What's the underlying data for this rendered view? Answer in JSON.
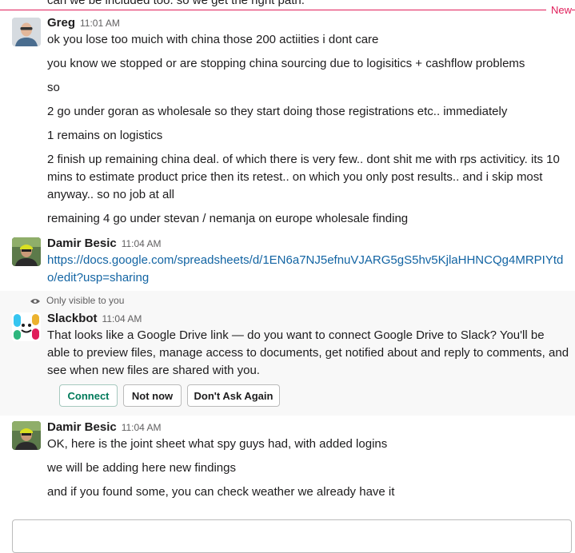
{
  "top_partial_text": "can we be included too. so we get the right path.",
  "new_divider_label": "New",
  "messages": [
    {
      "author": "Greg",
      "time": "11:01 AM",
      "lines": [
        "ok you lose too muich with china those 200 actiities i dont care",
        "you know we stopped or are stopping china sourcing due to logisitics + cashflow problems",
        "so",
        "2 go under goran as wholesale so they start doing those registrations etc.. immediately",
        "1 remains on logistics",
        "2 finish up remaining china deal. of which there is very few.. dont shit me with rps activiticy. its 10 mins to estimate product price then its retest.. on which you only post results.. and i skip most anyway.. so no job at all",
        "remaining 4 go under stevan / nemanja on europe wholesale finding"
      ]
    },
    {
      "author": "Damir Besic",
      "time": "11:04 AM",
      "link": "https://docs.google.com/spreadsheets/d/1EN6a7NJ5efnuVJARG5gS5hv5KjlaHHNCQg4MRPIYtdo/edit?usp=sharing"
    },
    {
      "visibility_note": "Only visible to you",
      "author": "Slackbot",
      "time": "11:04 AM",
      "text": "That looks like a Google Drive link — do you want to connect Google Drive to Slack? You'll be able to preview files, manage access to documents, get notified about and reply to comments, and see when new files are shared with you.",
      "buttons": [
        "Connect",
        "Not now",
        "Don't Ask Again"
      ]
    },
    {
      "author": "Damir Besic",
      "time": "11:04 AM",
      "lines": [
        "OK, here is the joint sheet what spy guys had, with added logins",
        "we will be adding here new findings",
        "and if you found some, you can check weather we already have it"
      ]
    }
  ]
}
